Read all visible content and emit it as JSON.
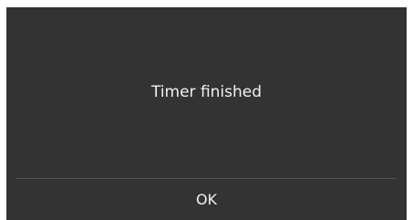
{
  "dialog": {
    "message": "Timer finished",
    "ok_label": "OK"
  },
  "colors": {
    "dialog_background": "#333333",
    "text": "#f2f2f2",
    "divider": "#555555"
  }
}
